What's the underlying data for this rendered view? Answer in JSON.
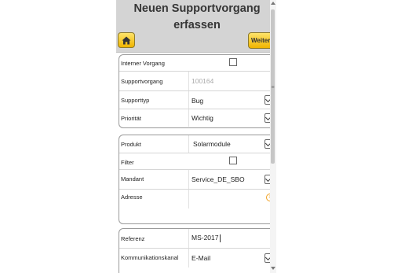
{
  "header": {
    "title": "Neuen Supportvorgang erfassen",
    "next_label": "Weiter"
  },
  "colors": {
    "button": "#f5c518",
    "header_bg": "#d4d4d4"
  },
  "group1": {
    "internal_label": "Interner Vorgang",
    "number_label": "Supportvorgang",
    "number_value": "100164",
    "type_label": "Supporttyp",
    "type_value": "Bug",
    "priority_label": "Priorität",
    "priority_value": "Wichtig"
  },
  "group2": {
    "product_label": "Produkt",
    "product_value": "Solarmodule",
    "filter_label": "Filter",
    "client_label": "Mandant",
    "client_value": "Service_DE_SBO",
    "address_label": "Adresse"
  },
  "group3": {
    "reference_label": "Referenz",
    "reference_value": "MS-2017",
    "channel_label": "Kommunikationskanal",
    "channel_value": "E-Mail"
  }
}
